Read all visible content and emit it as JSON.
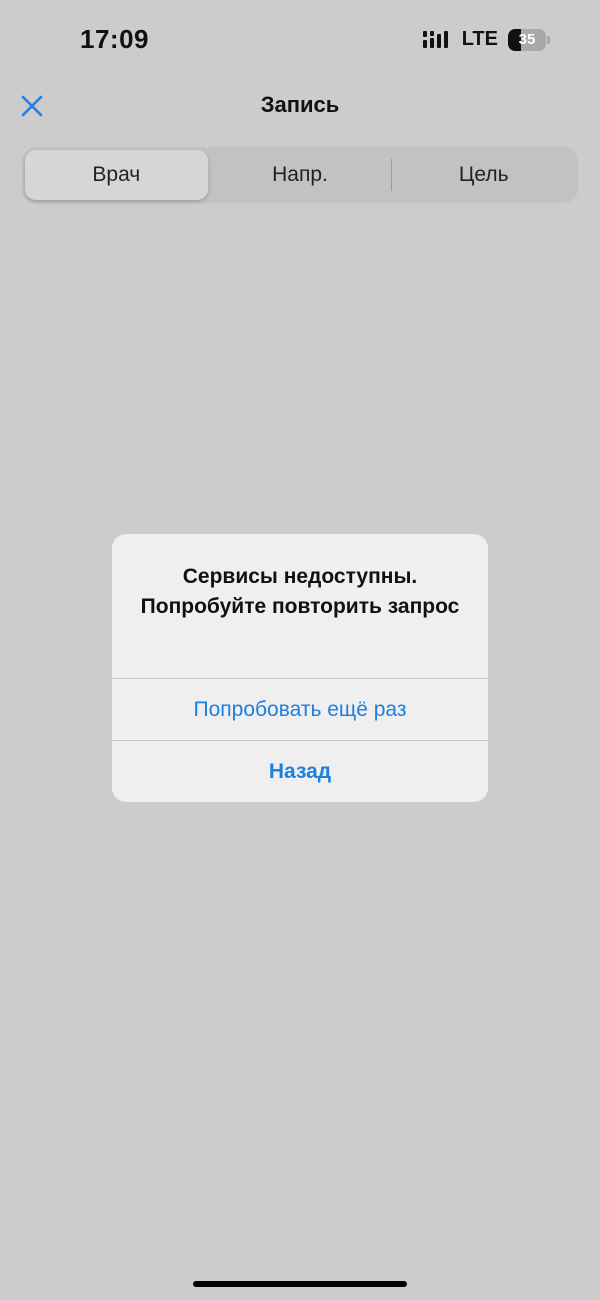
{
  "status_bar": {
    "time": "17:09",
    "network": "LTE",
    "battery_percent": "35",
    "battery_level": 0.35,
    "signal_icon": "signal-bars-icon"
  },
  "nav": {
    "title": "Запись",
    "close_icon": "close-icon"
  },
  "segments": {
    "items": [
      {
        "label": "Врач",
        "selected": true
      },
      {
        "label": "Напр.",
        "selected": false
      },
      {
        "label": "Цель",
        "selected": false
      }
    ]
  },
  "alert": {
    "message": "Сервисы недоступны. Попробуйте повторить запрос",
    "retry_label": "Попробовать ещё раз",
    "back_label": "Назад"
  },
  "colors": {
    "accent": "#1f7ee0",
    "background": "#cccccc",
    "alert_background": "#efefef"
  }
}
